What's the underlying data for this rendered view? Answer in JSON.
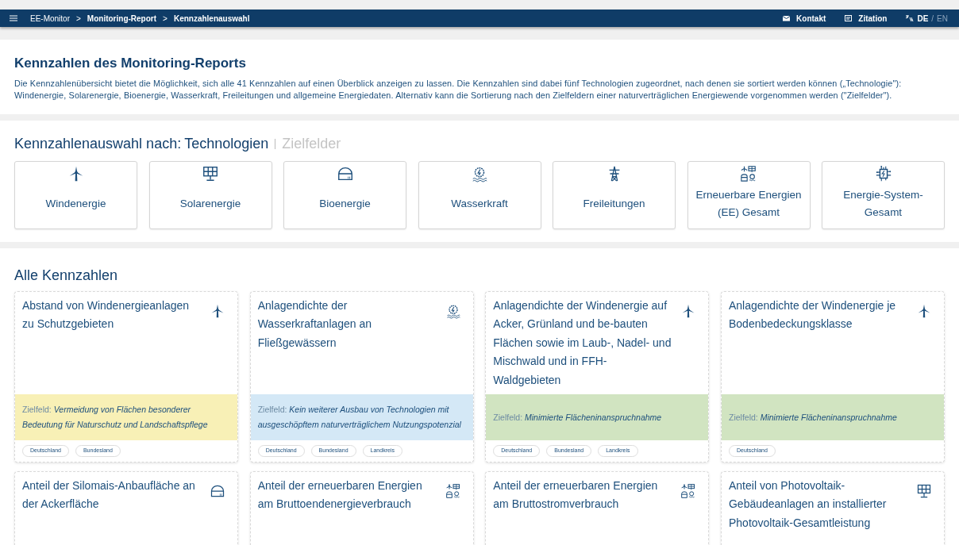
{
  "navbar": {
    "breadcrumb": [
      {
        "label": "EE-Monitor",
        "bold": false
      },
      {
        "label": "Monitoring-Report",
        "bold": true
      },
      {
        "label": "Kennzahlenauswahl",
        "bold": true
      }
    ],
    "separator": ">",
    "links": [
      {
        "label": "Kontakt",
        "kind": "mail"
      },
      {
        "label": "Zitation",
        "kind": "cite"
      }
    ],
    "languages": [
      {
        "label": "DE",
        "selected": true
      },
      {
        "label": "EN",
        "selected": false
      }
    ],
    "language_separator": "/"
  },
  "intro": {
    "title": "Kennzahlen des Monitoring-Reports",
    "text": "Die Kennzahlenübersicht bietet die Möglichkeit, sich alle 41 Kennzahlen auf einen Überblick anzeigen zu lassen. Die Kennzahlen sind dabei fünf Technologien zugeordnet, nach denen sie sortiert werden können („Technologie\"): Windenergie, Solarenergie, Bioenergie, Wasserkraft, Freileitungen und allgemeine Energiedaten. Alternativ kann die Sortierung nach den Zielfeldern einer naturverträglichen Energiewende vorgenommen werden (\"Zielfelder\")."
  },
  "selection": {
    "label": "Kennzahlenauswahl nach:",
    "options": [
      {
        "label": "Technologien",
        "selected": true
      },
      {
        "label": "Zielfelder",
        "selected": false
      }
    ],
    "technologies": [
      {
        "label": "Windenergie",
        "kind": "wind"
      },
      {
        "label": "Solarenergie",
        "kind": "solar"
      },
      {
        "label": "Bioenergie",
        "kind": "bio"
      },
      {
        "label": "Wasserkraft",
        "kind": "water"
      },
      {
        "label": "Freileitungen",
        "kind": "pylon"
      },
      {
        "label": "Erneuerbare Energien (EE) Gesamt",
        "kind": "ee"
      },
      {
        "label": "Energie-System-Gesamt",
        "kind": "system"
      }
    ]
  },
  "indicators": {
    "title": "Alle Kennzahlen",
    "cards": [
      {
        "title": "Abstand von Windenergieanlagen zu Schutzgebieten",
        "kind": "wind",
        "goal_label": "Zielfeld:",
        "goal": "Vermeidung von Flächen besonderer Bedeutung für Naturschutz und Landschaftspflege",
        "color": "#f8f0b6",
        "tags": [
          "Deutschland",
          "Bundesland"
        ]
      },
      {
        "title": "Anlagendichte der Wasserkraftanlagen an Fließgewässern",
        "kind": "water",
        "goal_label": "Zielfeld:",
        "goal": "Kein weiterer Ausbau von Technologien mit ausgeschöpftem naturverträglichem Nutzungspotenzial",
        "color": "#d4e8f6",
        "tags": [
          "Deutschland",
          "Bundesland",
          "Landkreis"
        ]
      },
      {
        "title": "Anlagendichte der Windenergie auf Acker, Grünland und be-bauten Flächen sowie im Laub-, Nadel- und Mischwald und in FFH-Waldgebieten",
        "kind": "wind",
        "goal_label": "Zielfeld:",
        "goal": "Minimierte Flächeninanspruchnahme",
        "color": "#d1e4c1",
        "tags": [
          "Deutschland",
          "Bundesland",
          "Landkreis"
        ]
      },
      {
        "title": "Anlagendichte der Windenergie je Bodenbedeckungsklasse",
        "kind": "wind",
        "goal_label": "Zielfeld:",
        "goal": "Minimierte Flächeninanspruchnahme",
        "color": "#d1e4c1",
        "tags": [
          "Deutschland"
        ]
      },
      {
        "title": "Anteil der Silomais-Anbaufläche an der Ackerfläche",
        "kind": "bio"
      },
      {
        "title": "Anteil der erneuerbaren Energien am Bruttoendenergieverbrauch",
        "kind": "ee"
      },
      {
        "title": "Anteil der erneuerbaren Energien am Bruttostromverbrauch",
        "kind": "ee"
      },
      {
        "title": "Anteil von Photovoltaik-Gebäudeanlagen an installierter Photovoltaik-Gesamtleistung",
        "kind": "solar"
      }
    ]
  }
}
